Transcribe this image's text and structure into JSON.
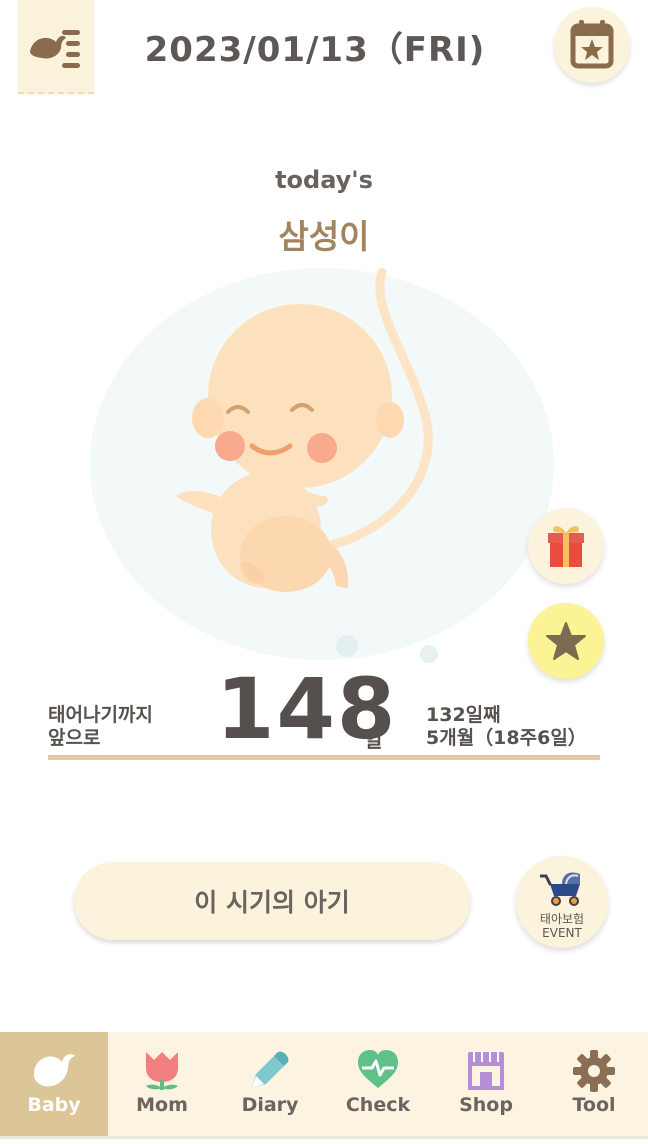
{
  "header": {
    "date": "2023/01/13（FRI)",
    "menu_icon": "bird-list-icon",
    "calendar_icon": "calendar-star-icon"
  },
  "hero": {
    "todays": "today's",
    "baby_name": "삼성이",
    "illustration": "fetus-illustration"
  },
  "side_buttons": {
    "gift_icon": "gift-icon",
    "star_icon": "star-icon"
  },
  "countdown": {
    "left_line1": "태어나기까지",
    "left_line2": "앞으로",
    "days_left": "148",
    "unit": "일",
    "right_line1": "132일째",
    "right_line2": "5개월（18주6일）"
  },
  "actions": {
    "baby_period_label": "이 시기의 아기",
    "event_line1": "태아보험",
    "event_line2": "EVENT",
    "event_icon": "stroller-icon"
  },
  "tabs": [
    {
      "label": "Baby",
      "icon": "bird-icon",
      "active": true
    },
    {
      "label": "Mom",
      "icon": "tulip-icon",
      "active": false
    },
    {
      "label": "Diary",
      "icon": "pencil-icon",
      "active": false
    },
    {
      "label": "Check",
      "icon": "heart-pulse-icon",
      "active": false
    },
    {
      "label": "Shop",
      "icon": "shop-icon",
      "active": false
    },
    {
      "label": "Tool",
      "icon": "gear-icon",
      "active": false
    }
  ],
  "colors": {
    "accent": "#dcc597",
    "cream": "#fcf3dd",
    "bar": "#e4c99d",
    "name": "#a2845f"
  }
}
